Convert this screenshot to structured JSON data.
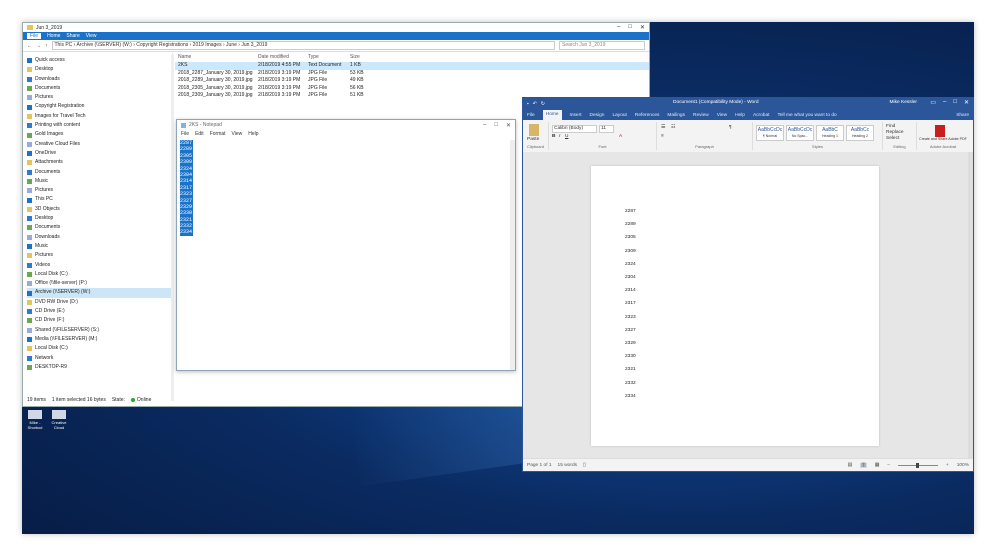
{
  "explorer": {
    "title": "Jun 3_2019",
    "ribbon_tabs": [
      "File",
      "Home",
      "Share",
      "View"
    ],
    "address_path": "This PC  ›  Archive (\\\\SERVER) (W:)  ›  Copyright Registrations  ›  2019 Images  ›  June  ›  Jun 3_2019",
    "search_placeholder": "Search Jun 3_2019",
    "nav_items": [
      "Quick access",
      "Desktop",
      "Downloads",
      "Documents",
      "Pictures",
      "Copyright Registration",
      "Images for Travel Tech",
      "Printing with content",
      "Gold Images",
      "Creative Cloud Files",
      "OneDrive",
      "Attachments",
      "Documents",
      "Music",
      "Pictures",
      "This PC",
      "3D Objects",
      "Desktop",
      "Documents",
      "Downloads",
      "Music",
      "Pictures",
      "Videos",
      "Local Disk (C:)",
      "Office (\\\\file-server) (P:)",
      "Archive (\\\\SERVER) (W:)",
      "DVD RW Drive (D:)",
      "CD Drive (E:)",
      "CD Drive (F:)",
      "Shared (\\\\FILESERVER) (S:)",
      "Media (\\\\FILESERVER) (M:)",
      "Local Disk (C:)",
      "Network",
      "DESKTOP-R9"
    ],
    "columns": [
      "Name",
      "Date modified",
      "Type",
      "Size"
    ],
    "files": [
      {
        "name": "2KS",
        "date": "2/18/2019 4:55 PM",
        "type": "Text Document",
        "size": "1 KB"
      },
      {
        "name": "2018_2287_January 30, 2019.jpg",
        "date": "2/18/2019 3:19 PM",
        "type": "JPG File",
        "size": "53 KB"
      },
      {
        "name": "2018_2289_January 30, 2019.jpg",
        "date": "2/18/2019 3:19 PM",
        "type": "JPG File",
        "size": "49 KB"
      },
      {
        "name": "2018_2305_January 30, 2019.jpg",
        "date": "2/18/2019 3:19 PM",
        "type": "JPG File",
        "size": "56 KB"
      },
      {
        "name": "2018_2309_January 30, 2019.jpg",
        "date": "2/18/2019 3:19 PM",
        "type": "JPG File",
        "size": "51 KB"
      }
    ],
    "status": {
      "count": "19 items",
      "selected": "1 item selected  16 bytes",
      "state": "State:",
      "online": "Online"
    },
    "controls": {
      "minimize": "–",
      "maximize": "□",
      "close": "✕"
    }
  },
  "notepad": {
    "title": "2KS - Notepad",
    "menu": [
      "File",
      "Edit",
      "Format",
      "View",
      "Help"
    ],
    "lines": [
      "2287",
      "2289",
      "2305",
      "2309",
      "2324",
      "2304",
      "2314",
      "2317",
      "2323",
      "2327",
      "2329",
      "2330",
      "2321",
      "2332",
      "2334"
    ],
    "controls": {
      "minimize": "–",
      "maximize": "□",
      "close": "✕"
    }
  },
  "word": {
    "title": "Document1 (Compatibility Mode) - Word",
    "user": "Mike Kessler",
    "tabs": [
      "File",
      "Home",
      "Insert",
      "Design",
      "Layout",
      "References",
      "Mailings",
      "Review",
      "View",
      "Help",
      "Acrobat",
      "Tell me what you want to do"
    ],
    "share": "Share",
    "ribbon": {
      "paste": "Paste",
      "clipboard": "Clipboard",
      "font_name": "Calibri (Body)",
      "font_size": "11",
      "font": "Font",
      "paragraph": "Paragraph",
      "styles": "Styles",
      "editing": "Editing",
      "find": "Find",
      "replace": "Replace",
      "select": "Select",
      "acrobat_label": "Create and Share Adobe PDF",
      "adobe_acrobat": "Adobe Acrobat",
      "style_samples": [
        {
          "sample": "AaBbCcDc",
          "name": "¶ Normal"
        },
        {
          "sample": "AaBbCcDc",
          "name": "No Spac..."
        },
        {
          "sample": "AaBbC",
          "name": "Heading 1"
        },
        {
          "sample": "AaBbCc",
          "name": "Heading 2"
        }
      ]
    },
    "document_lines": [
      "2287",
      "2289",
      "2305",
      "2309",
      "2324",
      "2304",
      "2314",
      "2317",
      "2323",
      "2327",
      "2329",
      "2330",
      "2321",
      "2332",
      "2334"
    ],
    "status": {
      "page": "Page 1 of 1",
      "words": "15 words",
      "zoom": "100%"
    },
    "controls": {
      "ribbon_display": "▭",
      "minimize": "–",
      "maximize": "□",
      "close": "✕"
    }
  },
  "desktop_icons": [
    {
      "label": "Mike - Shortcut"
    },
    {
      "label": "Creative Cloud"
    }
  ]
}
